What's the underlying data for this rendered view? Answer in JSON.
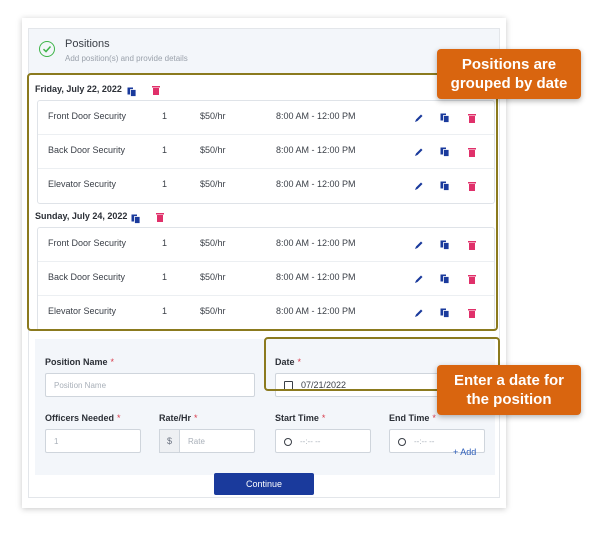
{
  "header": {
    "title": "Positions",
    "subtitle": "Add position(s) and provide details"
  },
  "groups": [
    {
      "date": "Friday, July 22, 2022",
      "rows": [
        {
          "name": "Front Door Security",
          "qty": "1",
          "rate": "$50/hr",
          "time": "8:00 AM - 12:00 PM"
        },
        {
          "name": "Back Door Security",
          "qty": "1",
          "rate": "$50/hr",
          "time": "8:00 AM - 12:00 PM"
        },
        {
          "name": "Elevator Security",
          "qty": "1",
          "rate": "$50/hr",
          "time": "8:00 AM - 12:00 PM"
        }
      ]
    },
    {
      "date": "Sunday, July 24, 2022",
      "rows": [
        {
          "name": "Front Door Security",
          "qty": "1",
          "rate": "$50/hr",
          "time": "8:00 AM - 12:00 PM"
        },
        {
          "name": "Back Door Security",
          "qty": "1",
          "rate": "$50/hr",
          "time": "8:00 AM - 12:00 PM"
        },
        {
          "name": "Elevator Security",
          "qty": "1",
          "rate": "$50/hr",
          "time": "8:00 AM - 12:00 PM"
        }
      ]
    }
  ],
  "form": {
    "position_name_label": "Position Name",
    "position_name_placeholder": "Position Name",
    "date_label": "Date",
    "date_value": "07/21/2022",
    "officers_label": "Officers Needed",
    "officers_placeholder": "1",
    "rate_label": "Rate/Hr",
    "rate_prefix": "$",
    "rate_placeholder": "Rate",
    "start_label": "Start Time",
    "start_placeholder": "--:-- --",
    "end_label": "End Time",
    "end_placeholder": "--:-- --",
    "required_mark": "*",
    "add_link": "+ Add"
  },
  "continue_label": "Continue",
  "callouts": {
    "grouped": "Positions are grouped by date",
    "date": "Enter a date for the position"
  },
  "colors": {
    "accent": "#1a3a9c",
    "delete": "#e0306a",
    "callout": "#d9650f",
    "highlight": "#8b7a1e",
    "success": "#3fb54a"
  },
  "icons": {
    "row_actions": [
      "pencil-icon",
      "copy-icon",
      "trash-icon"
    ],
    "group_actions": [
      "copy-icon",
      "trash-icon"
    ]
  }
}
